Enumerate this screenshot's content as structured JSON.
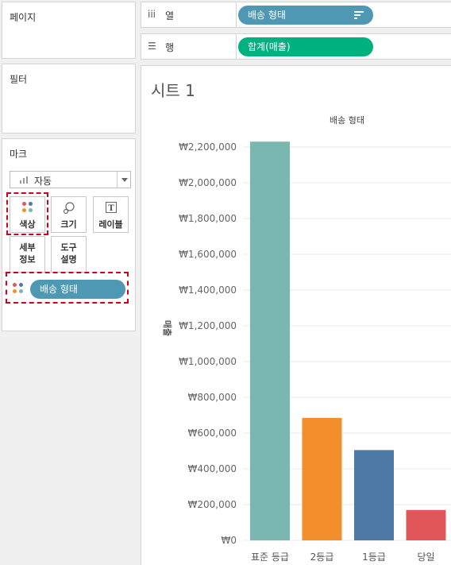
{
  "left_panel": {
    "pages_title": "페이지",
    "filters_title": "필터",
    "marks": {
      "title": "마크",
      "mark_type": "자동",
      "buttons": {
        "color": "색상",
        "size": "크기",
        "label": "레이블",
        "detail_line1": "세부",
        "detail_line2": "정보",
        "tooltip_line1": "도구",
        "tooltip_line2": "설명"
      },
      "color_pill": "배송 형태"
    }
  },
  "shelves": {
    "columns": {
      "icon": "iii",
      "label": "열",
      "pill": "배송 형태"
    },
    "rows": {
      "icon": "☰",
      "label": "행",
      "pill": "합계(매출)"
    }
  },
  "sheet": {
    "title": "시트 1"
  },
  "y_axis_label": "매출",
  "colors": {
    "pill_blue": "#4e98b3",
    "pill_green": "#00b180",
    "highlight": "#d0021b"
  },
  "chart_data": {
    "type": "bar",
    "title": "배송 형태",
    "xlabel": "",
    "ylabel": "매출",
    "categories": [
      "표준 등급",
      "2등급",
      "1등급",
      "당일"
    ],
    "values": [
      2230000,
      685000,
      505000,
      170000
    ],
    "colors": [
      "#79b7b0",
      "#f28e2b",
      "#4e79a7",
      "#e15759"
    ],
    "ylim": [
      0,
      2200000
    ],
    "yticks": [
      0,
      200000,
      400000,
      600000,
      800000,
      1000000,
      1200000,
      1400000,
      1600000,
      1800000,
      2000000,
      2200000
    ],
    "ytick_labels": [
      "₩0",
      "₩200,000",
      "₩400,000",
      "₩600,000",
      "₩800,000",
      "₩1,000,000",
      "₩1,200,000",
      "₩1,400,000",
      "₩1,600,000",
      "₩1,800,000",
      "₩2,000,000",
      "₩2,200,000"
    ],
    "grid": true,
    "legend": "none"
  }
}
